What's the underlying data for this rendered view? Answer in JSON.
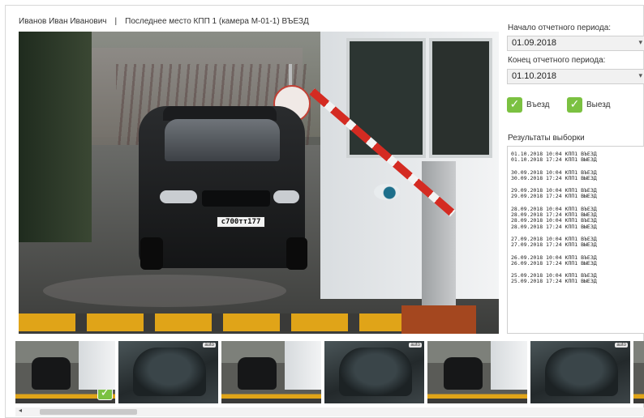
{
  "header": {
    "person": "Иванов Иван Иванович",
    "separator": "|",
    "last_place": "Последнее место КПП 1 (камера М-01-1) ВЪЕЗД"
  },
  "camera": {
    "plate_number": "с700тт177"
  },
  "filters": {
    "period_start_label": "Начало отчетного периода:",
    "period_start_value": "01.09.2018",
    "period_end_label": "Конец отчетного периода:",
    "period_end_value": "01.10.2018",
    "entry_label": "Въезд",
    "exit_label": "Выезд",
    "entry_checked": true,
    "exit_checked": true,
    "check_color": "#7bc141"
  },
  "results": {
    "title": "Результаты выборки",
    "groups": [
      [
        "01.10.2018 10:04 КПП1 ВЪЕЗД",
        "01.10.2018 17:24 КПП1 ВЫЕЗД"
      ],
      [
        "30.09.2018 10:04 КПП1 ВЪЕЗД",
        "30.09.2018 17:24 КПП1 ВЫЕЗД"
      ],
      [
        "29.09.2018 10:04 КПП1 ВЪЕЗД",
        "29.09.2018 17:24 КПП1 ВЫЕЗД"
      ],
      [
        "28.09.2018 10:04 КПП1 ВЪЕЗД",
        "28.09.2018 17:24 КПП1 ВЫЕЗД",
        "28.09.2018 10:04 КПП1 ВЪЕЗД",
        "28.09.2018 17:24 КПП1 ВЫЕЗД"
      ],
      [
        "27.09.2018 10:04 КПП1 ВЪЕЗД",
        "27.09.2018 17:24 КПП1 ВЫЕЗД"
      ],
      [
        "26.09.2018 10:04 КПП1 ВЪЕЗД",
        "26.09.2018 17:24 КПП1 ВЫЕЗД"
      ],
      [
        "25.09.2018 10:04 КПП1 ВЪЕЗД",
        "25.09.2018 17:24 КПП1 ВЫЕЗД"
      ]
    ]
  },
  "thumbnails": {
    "auto_tag": "auto",
    "items": [
      {
        "kind": "gate",
        "selected": true
      },
      {
        "kind": "close",
        "selected": false
      },
      {
        "kind": "gate",
        "selected": false
      },
      {
        "kind": "close",
        "selected": false
      },
      {
        "kind": "gate",
        "selected": false
      },
      {
        "kind": "close",
        "selected": false
      },
      {
        "kind": "gate",
        "selected": false
      }
    ]
  },
  "icons": {
    "check": "✓",
    "chevron_down": "▾",
    "scroll_left": "◂"
  }
}
